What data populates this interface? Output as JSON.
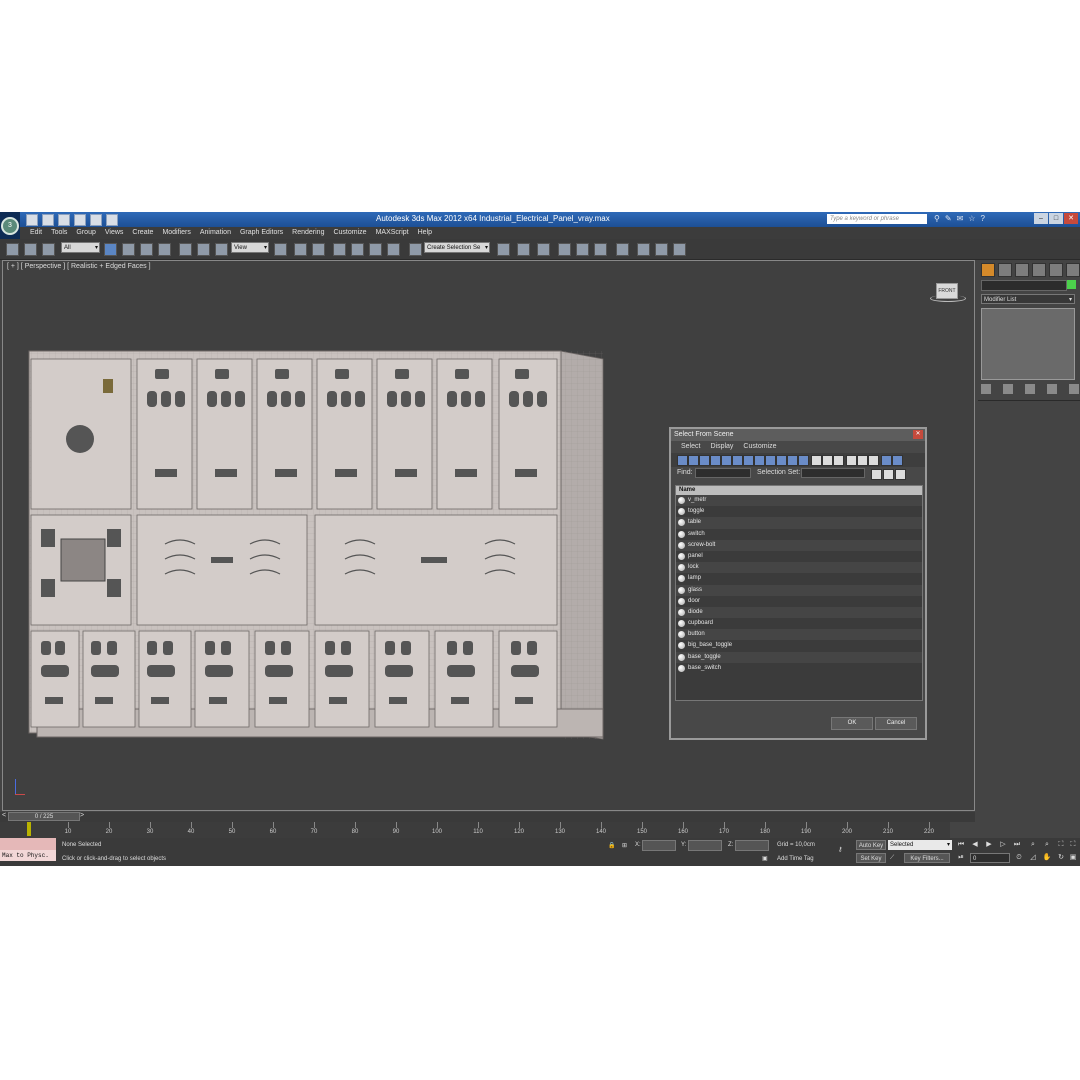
{
  "app": {
    "title": "Autodesk 3ds Max  2012 x64     Industrial_Electrical_Panel_vray.max",
    "search_placeholder": "Type a keyword or phrase",
    "logo": "3ds-max-logo-icon"
  },
  "menu": [
    "Edit",
    "Tools",
    "Group",
    "Views",
    "Create",
    "Modifiers",
    "Animation",
    "Graph Editors",
    "Rendering",
    "Customize",
    "MAXScript",
    "Help"
  ],
  "toolbar": {
    "selection_filter": "All",
    "reference_coord": "View",
    "named_selection": "Create Selection Se"
  },
  "viewport": {
    "label": "[ + ] [ Perspective ] [ Realistic + Edged Faces ]",
    "viewcube_label": "FRONT"
  },
  "dialog": {
    "title": "Select From Scene",
    "menu": [
      "Select",
      "Display",
      "Customize"
    ],
    "find_label": "Find:",
    "selection_set_label": "Selection Set:",
    "column_header": "Name",
    "items": [
      "v_metr",
      "toggle",
      "table",
      "switch",
      "screw-bolt",
      "panel",
      "lock",
      "lamp",
      "glass",
      "door",
      "diode",
      "cupboard",
      "button",
      "big_base_toggle",
      "base_toggle",
      "base_switch"
    ],
    "ok_label": "OK",
    "cancel_label": "Cancel"
  },
  "command_panel": {
    "modifier_list": "Modifier List"
  },
  "timeline": {
    "frame_counter": "0 / 225",
    "ticks": [
      "10",
      "20",
      "30",
      "40",
      "50",
      "60",
      "70",
      "80",
      "90",
      "100",
      "110",
      "120",
      "130",
      "140",
      "150",
      "160",
      "170",
      "180",
      "190",
      "200",
      "210",
      "220"
    ]
  },
  "status": {
    "script_listener": "Max to Physc.",
    "selection_state": "None Selected",
    "prompt": "Click or click-and-drag to select objects",
    "x_label": "X:",
    "y_label": "Y:",
    "z_label": "Z:",
    "grid": "Grid = 10,0cm",
    "add_time_tag": "Add Time Tag",
    "auto_key": "Auto Key",
    "set_key": "Set Key",
    "key_mode": "Selected",
    "key_filters": "Key Filters...",
    "frame": "0"
  },
  "colors": {
    "title_bar": "#1d4f95",
    "ui_background": "#444444",
    "model_color": "#c9c2bf",
    "wire_color": "#7a7472"
  }
}
